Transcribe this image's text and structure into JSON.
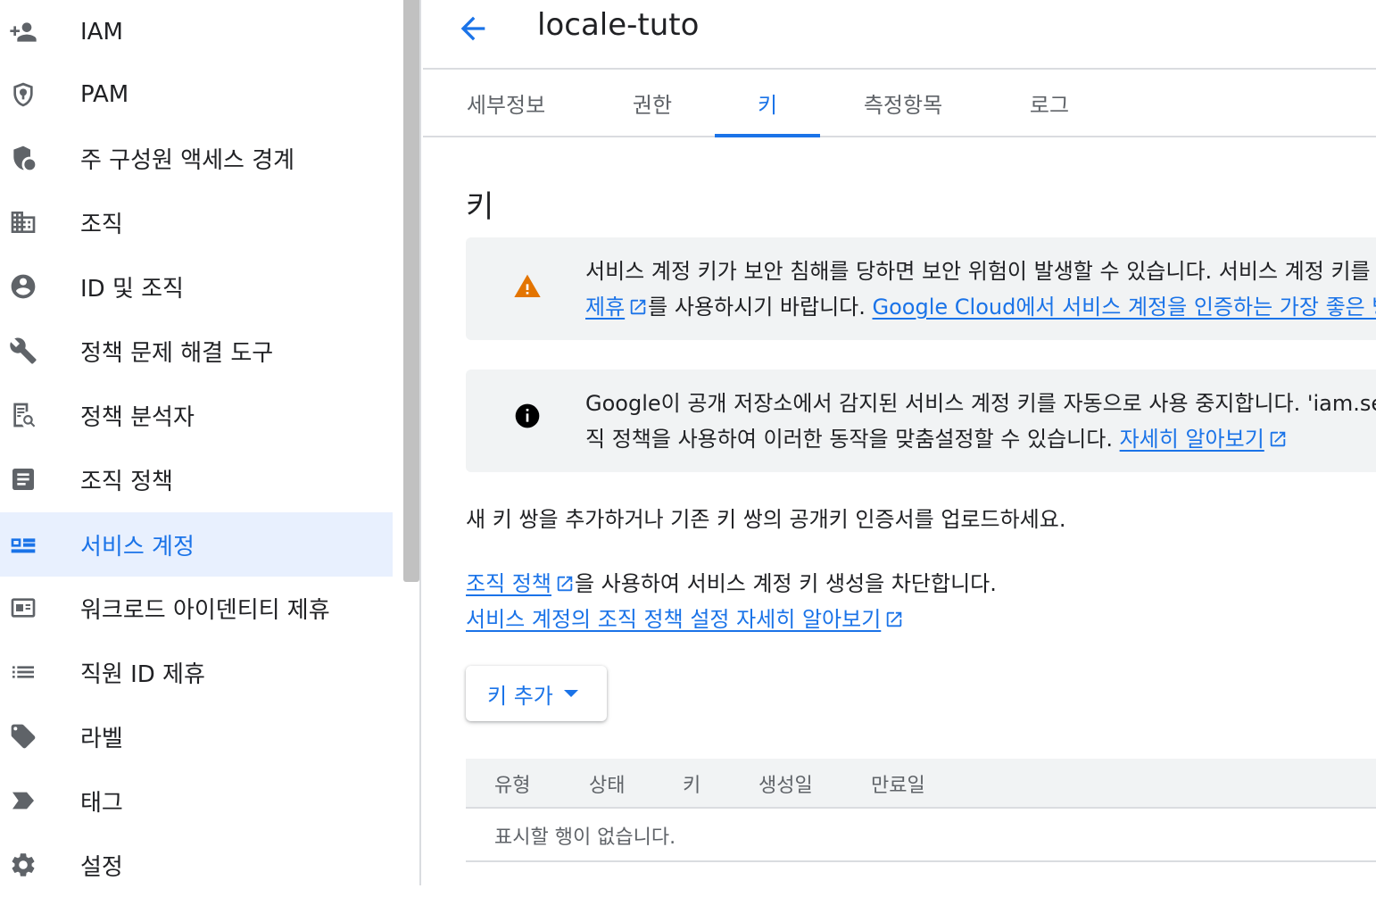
{
  "sidebar": {
    "items": [
      {
        "label": "IAM",
        "icon": "person-add-icon"
      },
      {
        "label": "PAM",
        "icon": "shield-lock-icon"
      },
      {
        "label": "주 구성원 액세스 경계",
        "icon": "shield-person-icon"
      },
      {
        "label": "조직",
        "icon": "organization-icon"
      },
      {
        "label": "ID 및 조직",
        "icon": "account-circle-icon"
      },
      {
        "label": "정책 문제 해결 도구",
        "icon": "wrench-icon"
      },
      {
        "label": "정책 분석자",
        "icon": "policy-search-icon"
      },
      {
        "label": "조직 정책",
        "icon": "document-icon"
      },
      {
        "label": "서비스 계정",
        "icon": "service-account-icon",
        "active": true
      },
      {
        "label": "워크로드 아이덴티티 제휴",
        "icon": "id-card-icon"
      },
      {
        "label": "직원 ID 제휴",
        "icon": "list-icon"
      },
      {
        "label": "라벨",
        "icon": "label-icon"
      },
      {
        "label": "태그",
        "icon": "tag-icon"
      },
      {
        "label": "설정",
        "icon": "gear-icon"
      }
    ]
  },
  "header": {
    "title": "locale-tuto",
    "back_icon": "arrow-back-icon"
  },
  "tabs": [
    {
      "label": "세부정보"
    },
    {
      "label": "권한"
    },
    {
      "label": "키",
      "active": true
    },
    {
      "label": "측정항목"
    },
    {
      "label": "로그"
    }
  ],
  "section": {
    "title": "키"
  },
  "warning_banner": {
    "icon": "warning-icon",
    "line1": "서비스 계정 키가 보안 침해를 당하면 보안 위험이 발생할 수 있습니다. 서비스 계정 키를 다운로드하는 대신 워크로드 아이덴티티",
    "link1": "제휴",
    "after_link1": "를 사용하시기 바랍니다.",
    "link2": "Google Cloud에서 서비스 계정을 인증하는 가장 좋은 방법"
  },
  "info_banner": {
    "icon": "info-icon",
    "line1": "Google이 공개 저장소에서 감지된 서비스 계정 키를 자동으로 사용 중지합니다. 'iam.serviceAccountKeyExposureResponse' 조",
    "line2": "직 정책을 사용하여 이러한 동작을 맞춤설정할 수 있습니다.",
    "link": "자세히 알아보기"
  },
  "description": "새 키 쌍을 추가하거나 기존 키 쌍의 공개키 인증서를 업로드하세요.",
  "policy_note": {
    "link": "조직 정책",
    "text": "을 사용하여 서비스 계정 키 생성을 차단합니다.",
    "learn_link": "서비스 계정의 조직 정책 설정 자세히 알아보기"
  },
  "add_key_button": {
    "label": "키 추가"
  },
  "table": {
    "columns": [
      "유형",
      "상태",
      "키",
      "생성일",
      "만료일"
    ],
    "empty_message": "표시할 행이 없습니다."
  },
  "colors": {
    "accent": "#1a73e8",
    "warning": "#e37400",
    "active_bg": "#e8f0fe"
  }
}
